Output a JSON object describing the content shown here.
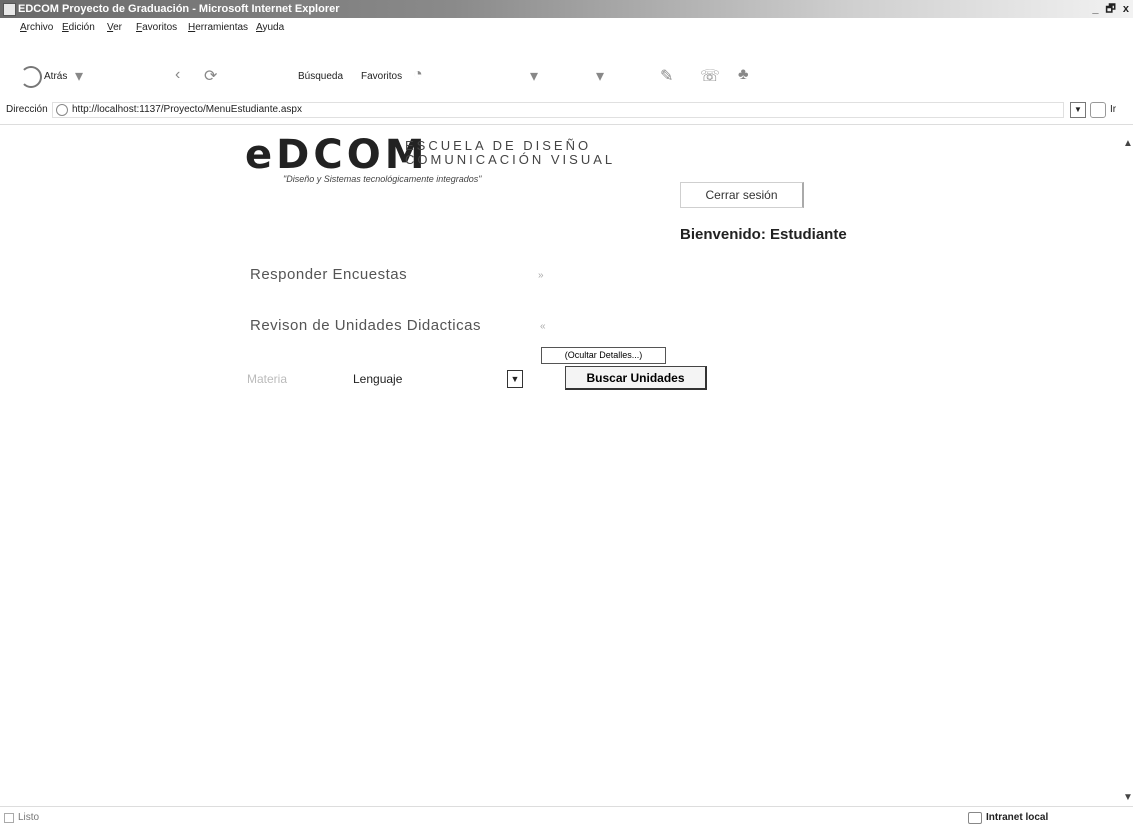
{
  "window": {
    "title": "EDCOM Proyecto de Graduación - Microsoft Internet Explorer",
    "controls": "_ 🗗 x"
  },
  "menubar": [
    "Archivo",
    "Edición",
    "Ver",
    "Favoritos",
    "Herramientas",
    "Ayuda"
  ],
  "toolbar": {
    "back_label": "Atrás",
    "search_label": "Búsqueda",
    "favorites_label": "Favoritos"
  },
  "address": {
    "label": "Dirección",
    "value": "http://localhost:1137/Proyecto/MenuEstudiante.aspx",
    "go_label": "Ir"
  },
  "logo": {
    "brand": "eDCOM",
    "school_line1": "ESCUELA DE DISEÑO",
    "school_line2": "COMUNICACIÓN VISUAL",
    "tagline": "\"Diseño y Sistemas tecnológicamente integrados\""
  },
  "session": {
    "logout_label": "Cerrar sesión",
    "welcome": "Bienvenido: Estudiante"
  },
  "menu": {
    "surveys_label": "Responder Encuestas",
    "units_label": "Revison de Unidades Didacticas",
    "hide_details_label": "(Ocultar Detalles...)"
  },
  "filter": {
    "subject_label": "Materia",
    "subject_value": "Lenguaje",
    "search_button": "Buscar Unidades"
  },
  "status": {
    "text": "Listo",
    "zone": "Intranet local"
  }
}
